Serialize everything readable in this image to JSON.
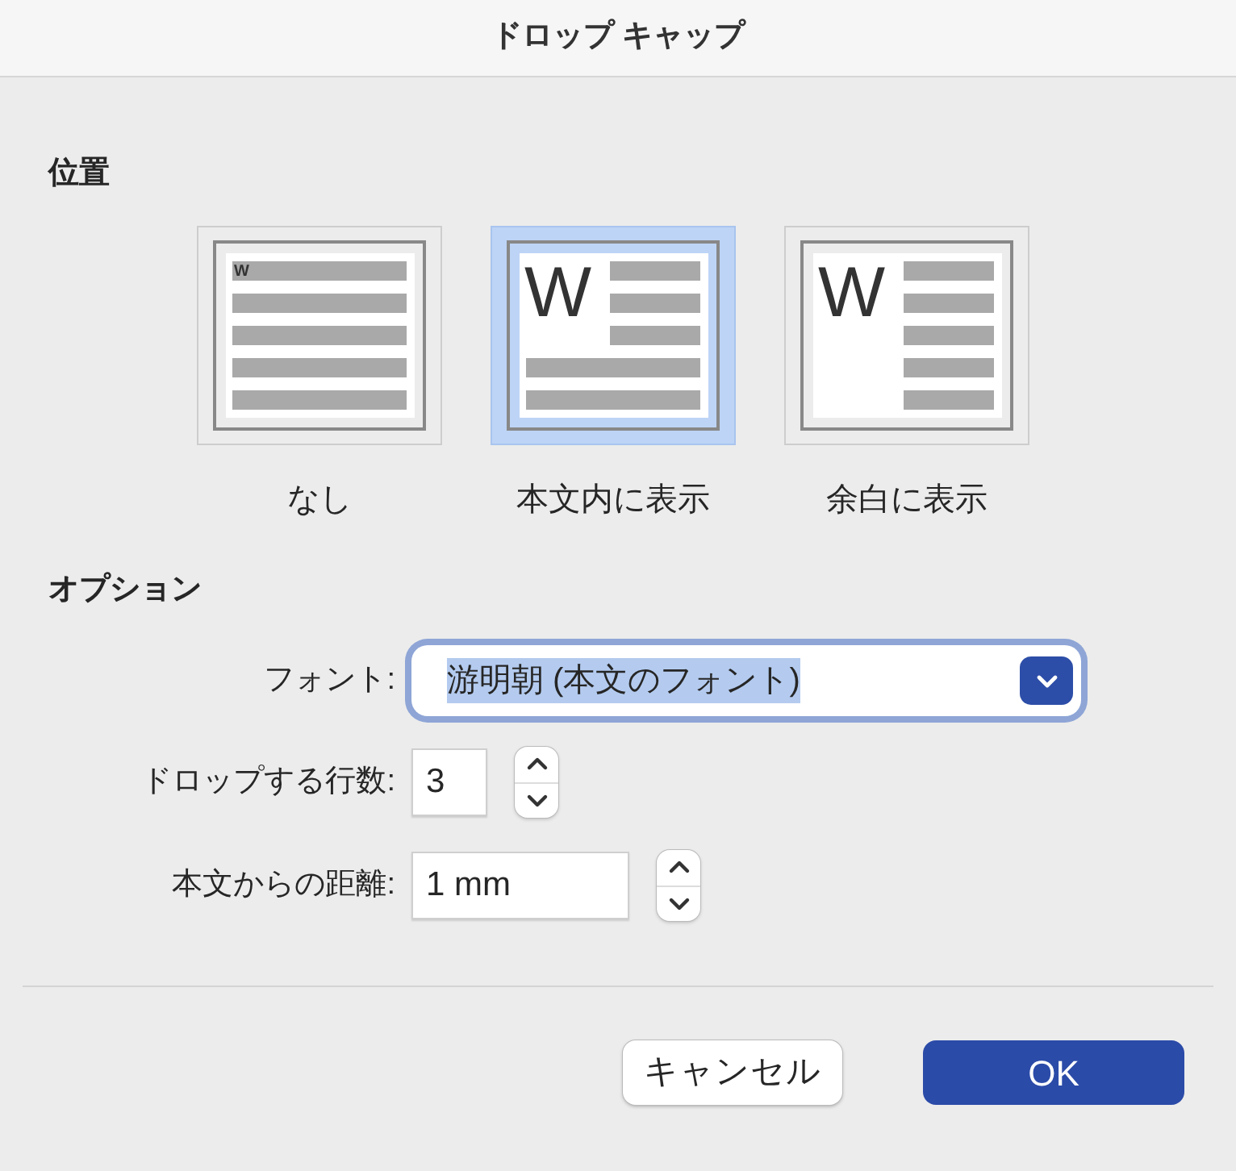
{
  "window": {
    "title": "ドロップ キャップ"
  },
  "position": {
    "heading": "位置",
    "options": [
      {
        "kind": "none",
        "letter": "W",
        "label": "なし",
        "selected": false
      },
      {
        "kind": "dropped",
        "letter": "W",
        "label": "本文内に表示",
        "selected": true
      },
      {
        "kind": "margin",
        "letter": "W",
        "label": "余白に表示",
        "selected": false
      }
    ]
  },
  "options": {
    "heading": "オプション",
    "font": {
      "label": "フォント:",
      "value": "游明朝 (本文のフォント)",
      "focused": true,
      "text_selected": true
    },
    "lines_to_drop": {
      "label": "ドロップする行数:",
      "value": "3"
    },
    "distance_from_text": {
      "label": "本文からの距離:",
      "value": "1 mm"
    }
  },
  "buttons": [
    {
      "kind": "cancel",
      "label": "キャンセル"
    },
    {
      "kind": "default",
      "label": "OK"
    }
  ]
}
